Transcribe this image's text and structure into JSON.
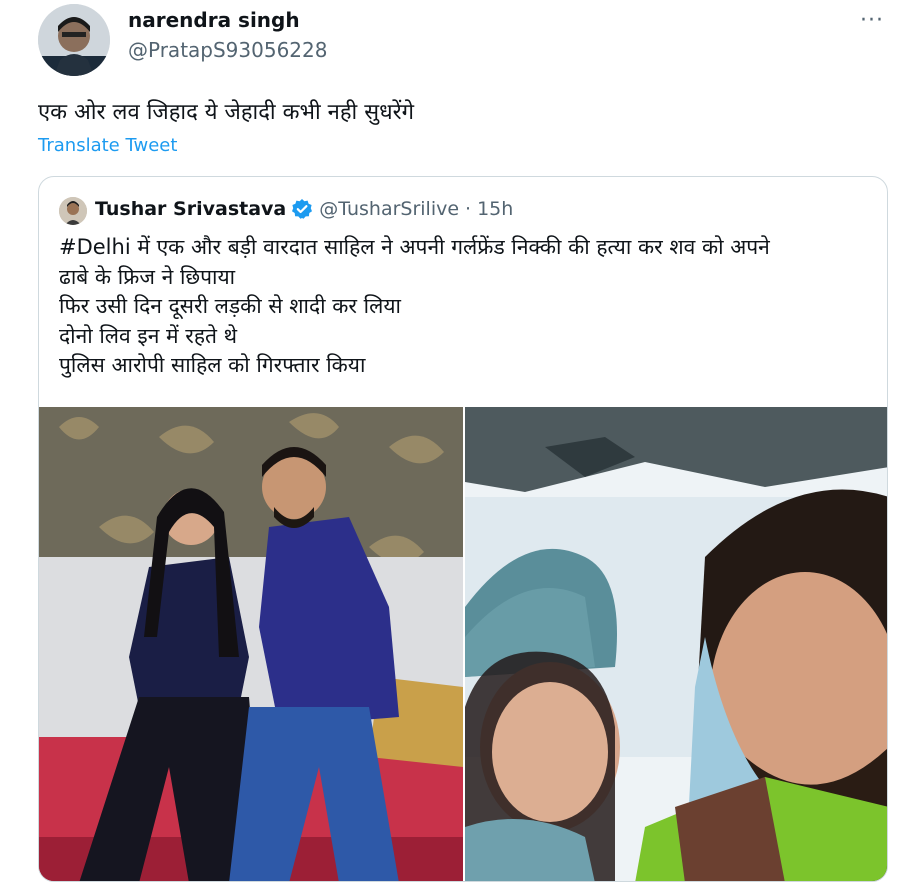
{
  "tweet": {
    "author_name": "narendra singh",
    "author_handle": "@PratapS93056228",
    "more_label": "···",
    "text": "एक ओर लव जिहाद ये जेहादी कभी नही सुधरेंगे",
    "translate_label": "Translate Tweet"
  },
  "quoted": {
    "author_name": "Tushar Srivastava",
    "author_handle": "@TusharSrilive",
    "separator": "·",
    "time": "15h",
    "lines": [
      "#Delhi में एक और बड़ी वारदात साहिल ने अपनी गर्लफ्रेंड निक्की की हत्या कर शव को अपने",
      "ढाबे के फ्रिज ने छिपाया",
      "फिर उसी दिन दूसरी लड़की से शादी कर लिया",
      "दोनो लिव इन में रहते थे",
      "पुलिस आरोपी साहिल को गिरफ्तार किया"
    ]
  },
  "icons": {
    "verified": "verified-badge-icon",
    "more": "more-options-icon"
  },
  "colors": {
    "link_blue": "#1d9bf0",
    "secondary_text": "#536471",
    "border": "#cfd9de"
  }
}
